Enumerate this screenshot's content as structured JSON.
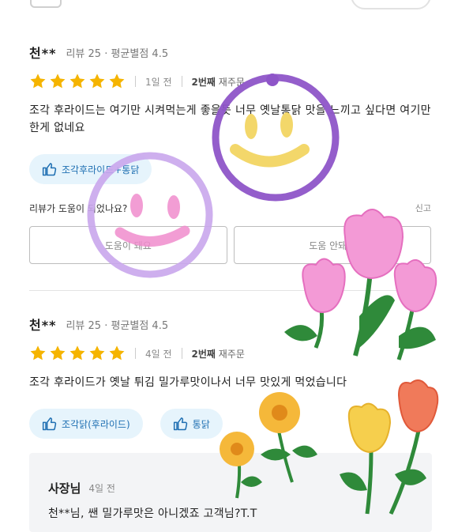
{
  "colors": {
    "star": "#f5b400",
    "tag_bg": "#e6f4fc",
    "tag_text": "#1f6fb2",
    "doodle_purple": "#8e55c8",
    "doodle_lilac": "#c9a6ec",
    "doodle_yellow": "#f3d76a",
    "doodle_pink": "#f08ccc"
  },
  "reviews": [
    {
      "author": "천**",
      "stats": "리뷰 25 · 평균별점 4.5",
      "rating": 5,
      "time": "1일 전",
      "order_bold": "2번째",
      "order_rest": " 재주문",
      "body": "조각 후라이드는 여기만 시켜먹는게 좋을듯 너무 옛날통닭 맛을 느끼고 싶다면 여기만한게 없네요",
      "tags": [
        "조각후라이드+통닭"
      ],
      "helpful_question": "리뷰가 도움이 되었나요?",
      "report": "신고",
      "helpful_yes": "도움이 돼요",
      "helpful_no": "도움 안돼요"
    },
    {
      "author": "천**",
      "stats": "리뷰 25 · 평균별점 4.5",
      "rating": 5,
      "time": "4일 전",
      "order_bold": "2번째",
      "order_rest": " 재주문",
      "body": "조각 후라이드가 옛날 튀김 밀가루맛이나서 너무 맛있게 먹었습니다",
      "tags": [
        "조각닭(후라이드)",
        "통닭"
      ]
    }
  ],
  "owner_reply": {
    "name": "사장님",
    "time": "4일 전",
    "text": "천**님, 쌘 밀가루맛은 아니겠죠 고객님?T.T"
  }
}
